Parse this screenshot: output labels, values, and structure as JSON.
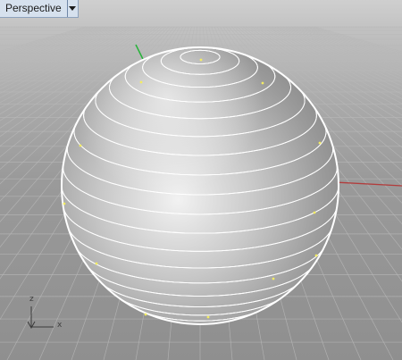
{
  "viewport": {
    "title": "Perspective",
    "dropdown_icon": "triangle-down-icon"
  },
  "gizmo": {
    "z_label": "z",
    "x_label": "x"
  },
  "colors": {
    "x_axis": "#b23c3c",
    "y_axis": "#27b33a",
    "wireframe": "#ffffff",
    "control_points": "#f3ec63",
    "grid": "#b8b8b8"
  },
  "scene": {
    "object": "geodesic-sphere-mesh",
    "display_mode": "shaded-with-wireframe"
  }
}
